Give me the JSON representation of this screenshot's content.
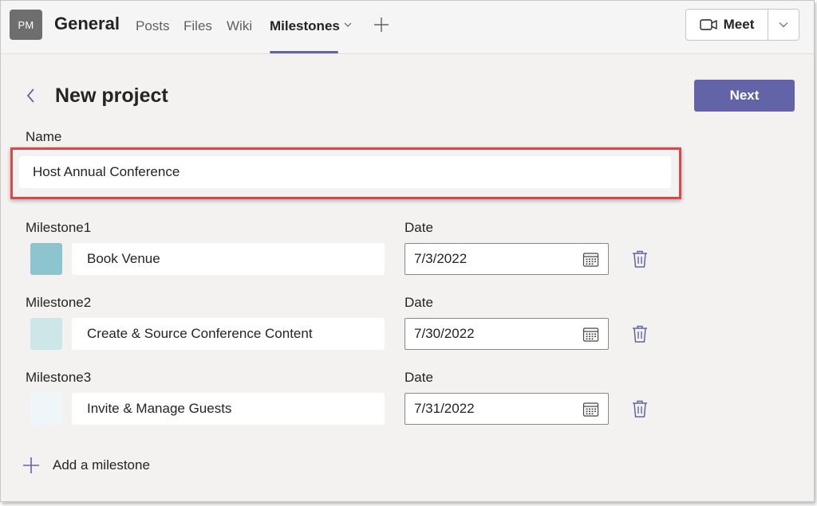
{
  "header": {
    "avatar_initials": "PM",
    "team_title": "General",
    "tabs": [
      {
        "label": "Posts"
      },
      {
        "label": "Files"
      },
      {
        "label": "Wiki"
      },
      {
        "label": "Milestones",
        "active": true
      }
    ],
    "meet_label": "Meet"
  },
  "page": {
    "title": "New project",
    "next_label": "Next"
  },
  "form": {
    "name_label": "Name",
    "name_value": "Host Annual Conference",
    "date_label": "Date",
    "milestones": [
      {
        "label": "Milestone1",
        "value": "Book Venue",
        "date": "7/3/2022",
        "color": "#8cc5cd"
      },
      {
        "label": "Milestone2",
        "value": "Create & Source Conference Content",
        "date": "7/30/2022",
        "color": "#cde6e8"
      },
      {
        "label": "Milestone3",
        "value": "Invite & Manage Guests",
        "date": "7/31/2022",
        "color": "#eef6f9"
      }
    ],
    "add_milestone_label": "Add a milestone"
  },
  "colors": {
    "accent": "#6264a7",
    "highlight_border": "#e04646"
  }
}
